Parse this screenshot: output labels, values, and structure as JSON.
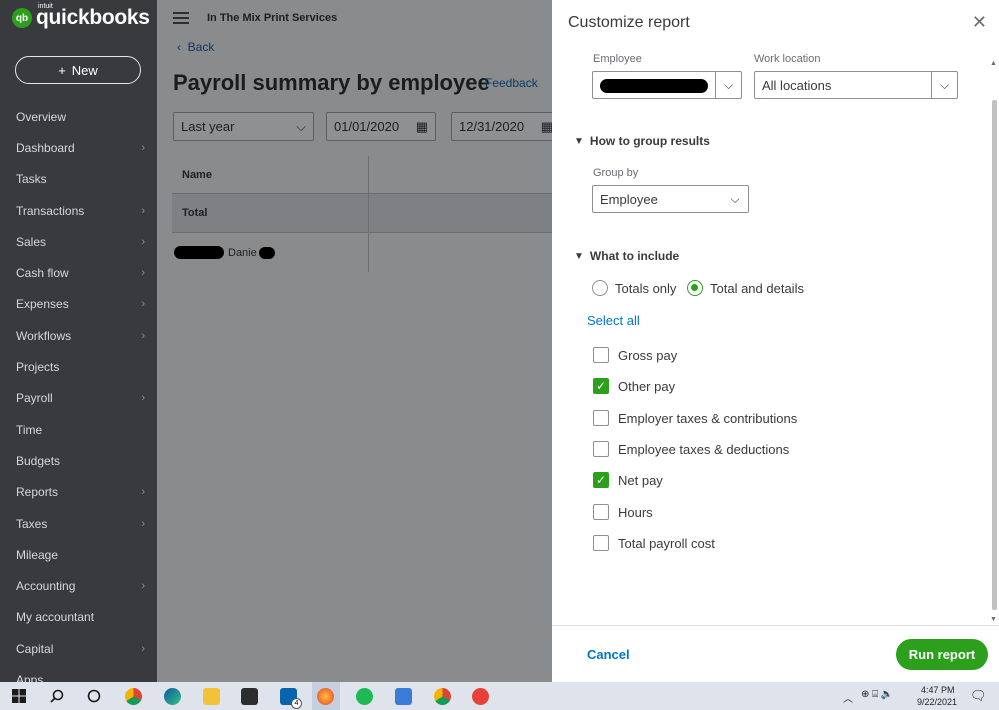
{
  "app": {
    "logo_small": "intuit",
    "logo_word": "quickbooks",
    "logo_mark": "qb"
  },
  "sidebar": {
    "new_label": "New",
    "items": [
      {
        "label": "Overview",
        "chevron": false
      },
      {
        "label": "Dashboard",
        "chevron": true
      },
      {
        "label": "Tasks",
        "chevron": false
      },
      {
        "label": "Transactions",
        "chevron": true
      },
      {
        "label": "Sales",
        "chevron": true
      },
      {
        "label": "Cash flow",
        "chevron": true
      },
      {
        "label": "Expenses",
        "chevron": true
      },
      {
        "label": "Workflows",
        "chevron": true
      },
      {
        "label": "Projects",
        "chevron": false
      },
      {
        "label": "Payroll",
        "chevron": true
      },
      {
        "label": "Time",
        "chevron": false
      },
      {
        "label": "Budgets",
        "chevron": false
      },
      {
        "label": "Reports",
        "chevron": true
      },
      {
        "label": "Taxes",
        "chevron": true
      },
      {
        "label": "Mileage",
        "chevron": false
      },
      {
        "label": "Accounting",
        "chevron": true
      },
      {
        "label": "My accountant",
        "chevron": false
      },
      {
        "label": "Capital",
        "chevron": true
      },
      {
        "label": "Apps",
        "chevron": false
      }
    ]
  },
  "header": {
    "company": "In The Mix Print Services",
    "back": "Back",
    "title": "Payroll summary by employee",
    "feedback": "Feedback"
  },
  "filters": {
    "period": "Last year",
    "start_date": "01/01/2020",
    "end_date": "12/31/2020"
  },
  "table": {
    "col_name": "Name",
    "total_label": "Total",
    "employee_name": "Danie"
  },
  "panel": {
    "title": "Customize report",
    "employee_label": "Employee",
    "work_location_label": "Work location",
    "work_location_value": "All locations",
    "group_section": "How to group results",
    "group_by_label": "Group by",
    "group_by_value": "Employee",
    "include_section": "What to include",
    "radio_totals": "Totals only",
    "radio_details": "Total and details",
    "select_all": "Select all",
    "checks": [
      {
        "label": "Gross pay",
        "checked": false
      },
      {
        "label": "Other pay",
        "checked": true
      },
      {
        "label": "Employer taxes & contributions",
        "checked": false
      },
      {
        "label": "Employee taxes & deductions",
        "checked": false
      },
      {
        "label": "Net pay",
        "checked": true
      },
      {
        "label": "Hours",
        "checked": false
      },
      {
        "label": "Total payroll cost",
        "checked": false
      }
    ],
    "cancel": "Cancel",
    "run": "Run report"
  },
  "taskbar": {
    "time": "4:47 PM",
    "date": "9/22/2021",
    "mail_badge": "4"
  },
  "colors": {
    "brand_green": "#2ca01c",
    "link_blue": "#0077c5",
    "sidebar_bg": "#393a3d"
  }
}
